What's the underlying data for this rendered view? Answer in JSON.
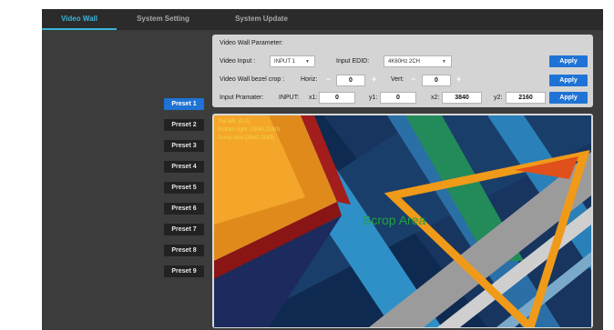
{
  "tabs": [
    {
      "label": "Video Wall",
      "active": true
    },
    {
      "label": "System Setting",
      "active": false
    },
    {
      "label": "System Update",
      "active": false
    }
  ],
  "presets": [
    "Preset 1",
    "Preset 2",
    "Preset 3",
    "Preset 4",
    "Preset 5",
    "Preset 6",
    "Preset 7",
    "Preset 8",
    "Preset 9"
  ],
  "active_preset": "Preset 1",
  "panel": {
    "title": "Video Wall Parameter:",
    "video_input_label": "Video Input :",
    "video_input_value": "INPUT 1",
    "input_edid_label": "Input EDID:",
    "input_edid_value": "4K60Hz 2CH",
    "bezel_label": "Video Wall bezel crop :",
    "horiz_label": "Horiz:",
    "horiz_value": "0",
    "vert_label": "Vert:",
    "vert_value": "0",
    "minus": "−",
    "plus": "+",
    "param_label": "Input Pramater:",
    "input_label": "INPUT:",
    "x1_label": "x1:",
    "x1_value": "0",
    "y1_label": "y1:",
    "y1_value": "0",
    "x2_label": "x2:",
    "x2_value": "3840",
    "y2_label": "y2:",
    "y2_value": "2160",
    "apply_label": "Apply"
  },
  "preview": {
    "top_left": "Top left: (0,0)",
    "bottom_right": "Bottom right: (3840,2160)",
    "scrop_size": "Scrop size:(3840,2160)",
    "scrop_area": "Scrop Area"
  },
  "colors": {
    "accent": "#3ab4d8",
    "button_blue": "#1f73d6",
    "info_text": "#f2d64a",
    "scrop_text": "#1fa33a"
  }
}
